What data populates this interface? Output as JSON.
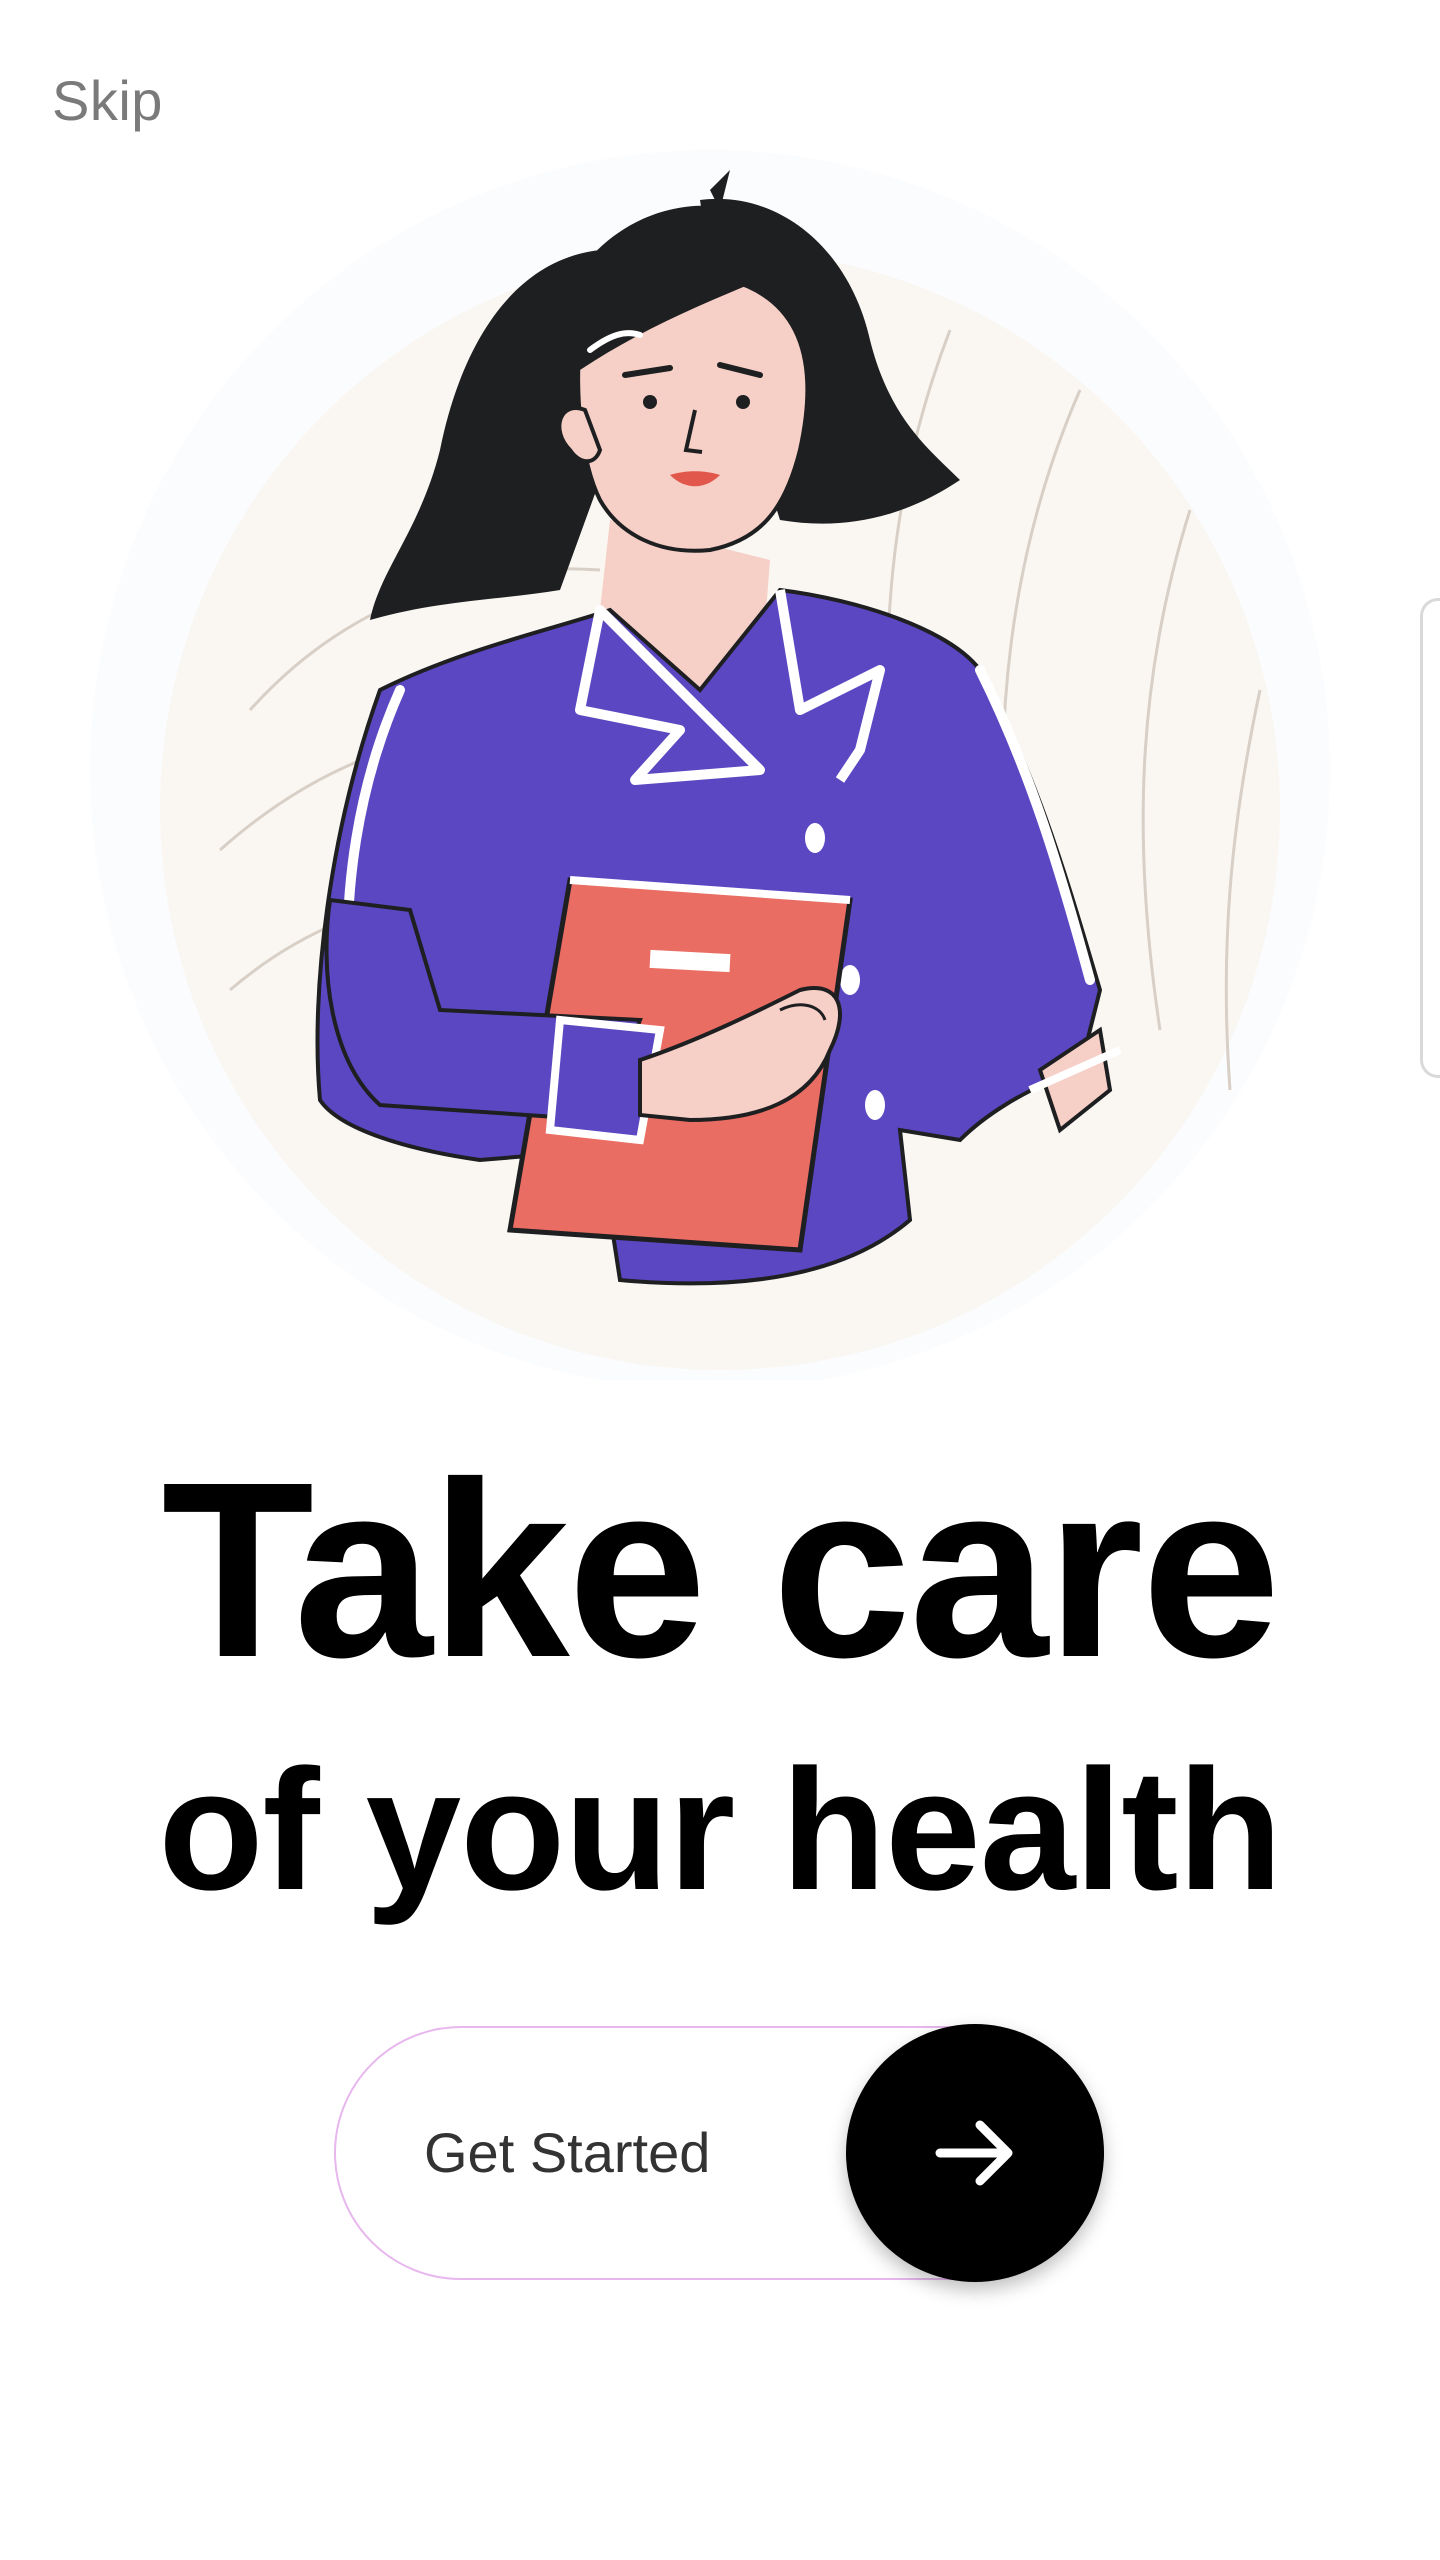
{
  "header": {
    "skip_label": "Skip"
  },
  "hero": {
    "illustration": "woman-holding-notebook-illustration"
  },
  "headline": {
    "line1": "Take care",
    "line2": "of your health"
  },
  "cta": {
    "label": "Get Started",
    "icon": "arrow-right-icon"
  },
  "colors": {
    "background": "#ffffff",
    "text_primary": "#000000",
    "text_muted": "#7a7a7a",
    "cta_border": "#e7b7ee",
    "cta_arrow_bg": "#000000",
    "jacket": "#5a47c1",
    "notebook": "#ea6d63",
    "skin": "#f6cfc7",
    "hair": "#1e1f21",
    "backdrop": "#faf7f3"
  }
}
